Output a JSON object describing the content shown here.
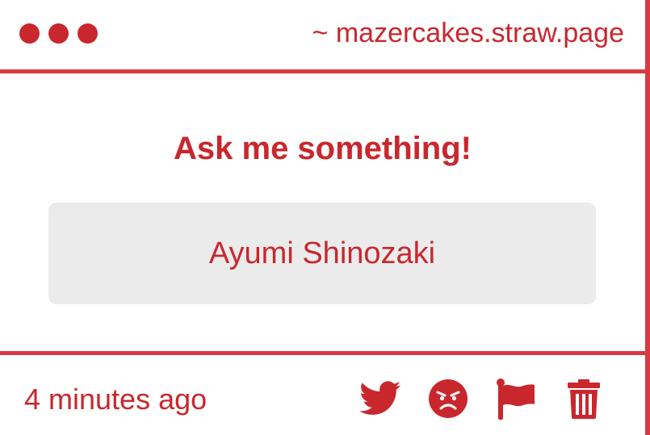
{
  "header": {
    "window_dots": [
      "dot",
      "dot",
      "dot"
    ],
    "site_url": "~ mazercakes.straw.page"
  },
  "main": {
    "prompt_title": "Ask me something!",
    "question_text": "Ayumi Shinozaki"
  },
  "footer": {
    "timestamp": "4 minutes ago",
    "actions": [
      {
        "name": "twitter-share",
        "icon": "twitter-bird-icon"
      },
      {
        "name": "angry-react",
        "icon": "angry-face-icon"
      },
      {
        "name": "report",
        "icon": "flag-icon"
      },
      {
        "name": "delete",
        "icon": "trash-icon"
      }
    ]
  },
  "colors": {
    "accent": "#c9272e",
    "border": "#d93a42",
    "question_bg": "#ecebec",
    "background": "#ffffff"
  }
}
